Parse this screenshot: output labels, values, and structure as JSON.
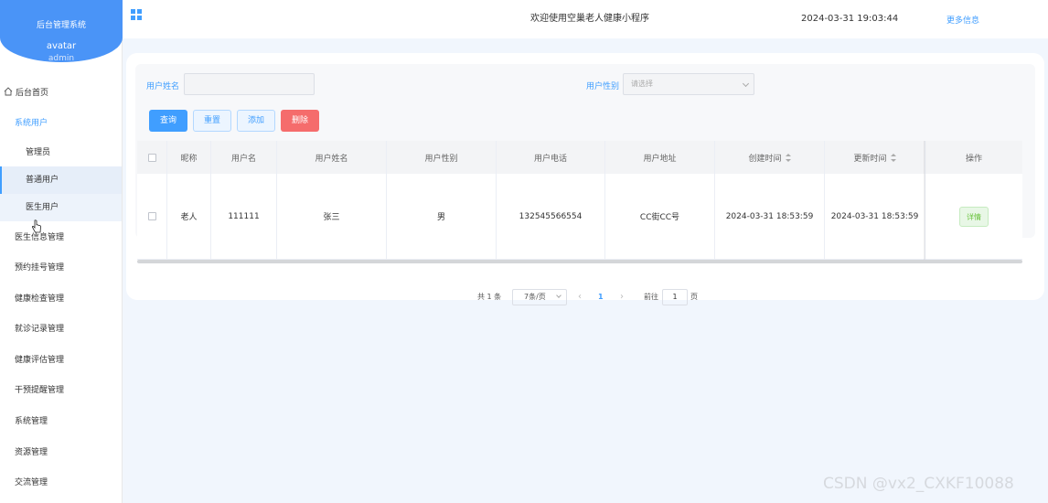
{
  "sidebar": {
    "brand_title": "后台管理系统",
    "avatar_alt": "avatar",
    "username": "admin",
    "home": "后台首页",
    "group_label": "系统用户",
    "sub_items": [
      "管理员",
      "普通用户",
      "医生用户"
    ],
    "items": [
      "医生信息管理",
      "预约挂号管理",
      "健康检查管理",
      "就诊记录管理",
      "健康评估管理",
      "干预提醒管理",
      "系统管理",
      "资源管理",
      "交流管理"
    ]
  },
  "header": {
    "title": "欢迎使用空巢老人健康小程序",
    "datetime": "2024-03-31 19:03:44",
    "more": "更多信息"
  },
  "search": {
    "name_label": "用户姓名",
    "name_value": "",
    "gender_label": "用户性别",
    "gender_placeholder": "请选择"
  },
  "buttons": {
    "query": "查询",
    "reset": "重置",
    "add": "添加",
    "delete": "删除"
  },
  "table": {
    "headers": [
      "昵称",
      "用户名",
      "用户姓名",
      "用户性别",
      "用户电话",
      "用户地址",
      "创建时间",
      "更新时间",
      "操作"
    ],
    "rows": [
      {
        "nickname": "老人",
        "username": "111111",
        "realname": "张三",
        "gender": "男",
        "phone": "132545566554",
        "address": "CC街CC号",
        "created": "2024-03-31 18:53:59",
        "updated": "2024-03-31 18:53:59",
        "action": "详情"
      }
    ]
  },
  "pagination": {
    "total": "共 1 条",
    "page_size": "7条/页",
    "prev": "‹",
    "current": "1",
    "next": "›",
    "goto_label": "前往",
    "goto_value": "1",
    "page_suffix": "页"
  },
  "watermark": "CSDN @vx2_CXKF10088",
  "colors": {
    "primary": "#409eff",
    "danger": "#f56c6c",
    "success": "#67c23a",
    "brand": "#4a94f7"
  }
}
